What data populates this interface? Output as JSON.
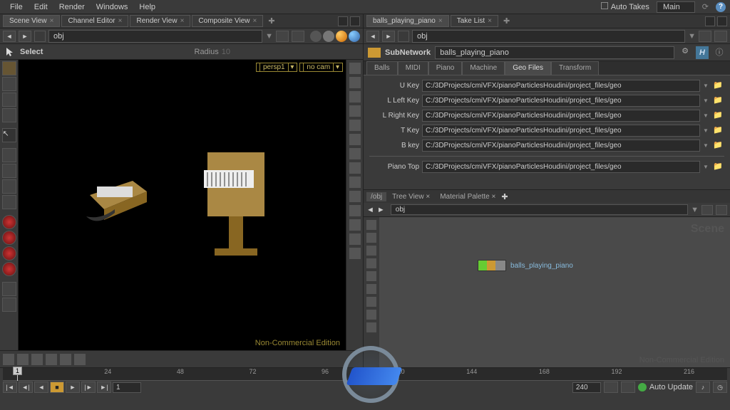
{
  "menubar": {
    "items": [
      "File",
      "Edit",
      "Render",
      "Windows",
      "Help"
    ],
    "auto_takes": "Auto Takes",
    "take_dropdown": "Main"
  },
  "left": {
    "tabs": [
      "Scene View",
      "Channel Editor",
      "Render View",
      "Composite View"
    ],
    "path": "obj",
    "select_label": "Select",
    "radius_label": "Radius",
    "radius_val": "10",
    "cam1": "persp1",
    "cam2": "no cam",
    "watermark": "Non-Commercial Edition"
  },
  "right_top": {
    "tabs": [
      "balls_playing_piano",
      "Take List"
    ],
    "path": "obj",
    "subnet_type": "SubNetwork",
    "subnet_name": "balls_playing_piano",
    "param_tabs": [
      "Balls",
      "MIDI",
      "Piano",
      "Machine",
      "Geo Files",
      "Transform"
    ],
    "active_ptab": 4,
    "rows": [
      {
        "label": "U Key",
        "value": "C:/3DProjects/cmiVFX/pianoParticlesHoudini/project_files/geo"
      },
      {
        "label": "L Left Key",
        "value": "C:/3DProjects/cmiVFX/pianoParticlesHoudini/project_files/geo"
      },
      {
        "label": "L Right Key",
        "value": "C:/3DProjects/cmiVFX/pianoParticlesHoudini/project_files/geo"
      },
      {
        "label": "T Key",
        "value": "C:/3DProjects/cmiVFX/pianoParticlesHoudini/project_files/geo"
      },
      {
        "label": "B key",
        "value": "C:/3DProjects/cmiVFX/pianoParticlesHoudini/project_files/geo"
      }
    ],
    "rows2": [
      {
        "label": "Piano Top",
        "value": "C:/3DProjects/cmiVFX/pianoParticlesHoudini/project_files/geo"
      }
    ]
  },
  "network": {
    "tabs": [
      "/obj",
      "Tree View",
      "Material Palette"
    ],
    "path": "obj",
    "scene_txt": "Scene",
    "watermark": "Non-Commercial Edition",
    "node_label": "balls_playing_piano"
  },
  "timeline": {
    "ticks": [
      {
        "pos": 14,
        "label": "24"
      },
      {
        "pos": 24,
        "label": "48"
      },
      {
        "pos": 34,
        "label": "72"
      },
      {
        "pos": 44,
        "label": "96"
      },
      {
        "pos": 54,
        "label": "120"
      },
      {
        "pos": 64,
        "label": "144"
      },
      {
        "pos": 74,
        "label": "168"
      },
      {
        "pos": 84,
        "label": "192"
      },
      {
        "pos": 94,
        "label": "216"
      }
    ],
    "marker": "1",
    "frame_start": "1",
    "frame_end": "240",
    "auto_update": "Auto Update"
  }
}
